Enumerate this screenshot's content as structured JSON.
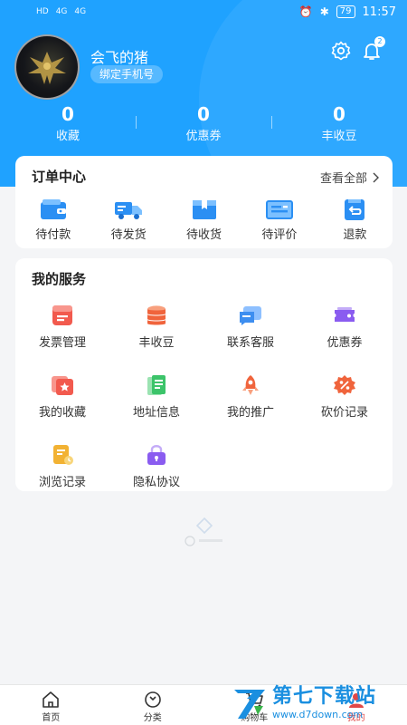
{
  "status_bar": {
    "left_indicators": [
      "HD",
      "4G",
      "4G"
    ],
    "battery": "79",
    "time": "11:57"
  },
  "profile": {
    "username": "会飞的猪",
    "bind_phone": "绑定手机号",
    "notification_count": "2"
  },
  "stats": [
    {
      "value": "0",
      "label": "收藏"
    },
    {
      "value": "0",
      "label": "优惠券"
    },
    {
      "value": "0",
      "label": "丰收豆"
    }
  ],
  "order_center": {
    "title": "订单中心",
    "view_all": "查看全部",
    "items": [
      {
        "label": "待付款",
        "icon": "wallet-icon"
      },
      {
        "label": "待发货",
        "icon": "truck-icon"
      },
      {
        "label": "待收货",
        "icon": "box-icon"
      },
      {
        "label": "待评价",
        "icon": "review-icon"
      },
      {
        "label": "退款",
        "icon": "refund-icon"
      }
    ]
  },
  "services": {
    "title": "我的服务",
    "items": [
      {
        "label": "发票管理",
        "icon": "invoice-icon",
        "color": "#f25a4e"
      },
      {
        "label": "丰收豆",
        "icon": "coin-stack-icon",
        "color": "#f0643c"
      },
      {
        "label": "联系客服",
        "icon": "chat-icon",
        "color": "#3d8ef0"
      },
      {
        "label": "优惠券",
        "icon": "coupon-icon",
        "color": "#8a5cf0"
      },
      {
        "label": "我的收藏",
        "icon": "favorite-icon",
        "color": "#f25a4e"
      },
      {
        "label": "地址信息",
        "icon": "address-icon",
        "color": "#3cc46a"
      },
      {
        "label": "我的推广",
        "icon": "rocket-icon",
        "color": "#f0643c"
      },
      {
        "label": "砍价记录",
        "icon": "discount-icon",
        "color": "#f0643c"
      },
      {
        "label": "浏览记录",
        "icon": "history-icon",
        "color": "#f2b233"
      },
      {
        "label": "隐私协议",
        "icon": "lock-icon",
        "color": "#8a5cf0"
      }
    ]
  },
  "bottom_nav": [
    {
      "label": "首页",
      "icon": "home-icon"
    },
    {
      "label": "分类",
      "icon": "category-icon"
    },
    {
      "label": "购物车",
      "icon": "cart-icon"
    },
    {
      "label": "我的",
      "icon": "user-icon"
    }
  ],
  "watermark": {
    "cn": "第七下载站",
    "url": "www.d7down.com"
  },
  "colors": {
    "header": "#1fa2ff",
    "accent_blue": "#1fa2ff",
    "active_nav": "#e04848"
  }
}
